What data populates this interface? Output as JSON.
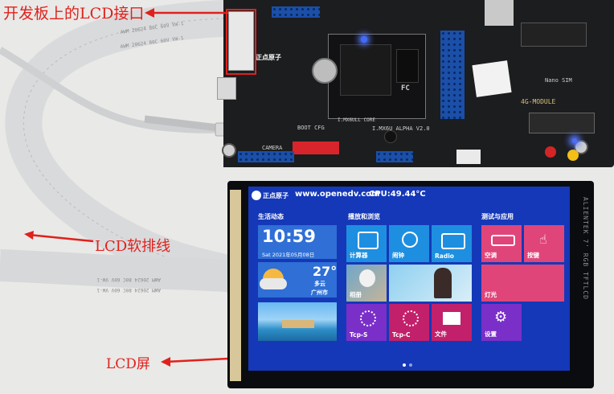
{
  "annotations": {
    "board_lcd_port": "开发板上的LCD接口",
    "ribbon_cable": "LCD软排线",
    "lcd_screen": "LCD屏"
  },
  "board": {
    "brand": "正点原子",
    "model_label": "I.MX6U ALPHA V2.0",
    "boot_cfg": "BOOT CFG",
    "core_label": "I.MX6ULL CORE",
    "camera_label": "CAMERA",
    "module_label": "4G-MODULE",
    "nano_sim": "Nano SIM",
    "fc_mark": "FC"
  },
  "lcd": {
    "header": {
      "logo_text": "正点原子",
      "url": "www.openedv.com",
      "cpu": "CPU:49.44°C"
    },
    "sections": {
      "status": "生活动态",
      "media": "播放和浏览",
      "apps": "测试与应用"
    },
    "clock": {
      "time": "10:59",
      "date": "Sat 2021年05月08日"
    },
    "weather": {
      "temp": "27°",
      "condition": "多云",
      "city": "广州市"
    },
    "tiles": {
      "calculator": "计算器",
      "alarm": "闹钟",
      "radio": "Radio",
      "photo": "相册",
      "tcps": "Tcp-S",
      "tcpc": "Tcp-C",
      "file": "文件",
      "ac": "空调",
      "keys": "按键",
      "led": "灯光",
      "settings": "设置"
    },
    "side_silk": "ALIENTEK 7' RGB TFTLCD",
    "colors": {
      "background": "#1538b8",
      "tile_blue": "#1e8fe0",
      "tile_pink": "#e0457a",
      "tile_magenta": "#c2206a",
      "tile_purple": "#7a2fc8",
      "annotation": "#e0211c"
    }
  }
}
